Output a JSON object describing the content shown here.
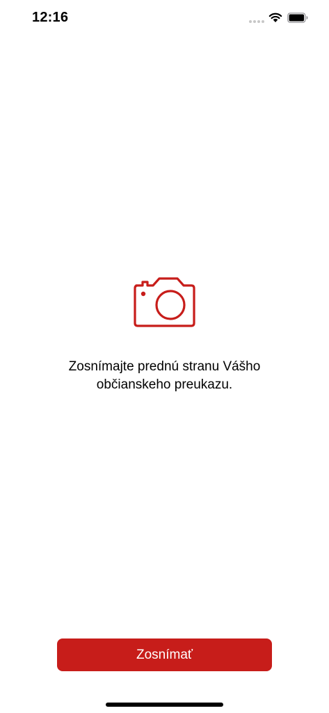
{
  "status_bar": {
    "time": "12:16"
  },
  "main": {
    "instruction": "Zosnímajte prednú stranu Vášho občianskeho preukazu.",
    "icon": "camera-icon"
  },
  "footer": {
    "capture_button_label": "Zosnímať"
  },
  "colors": {
    "accent": "#c71d1a",
    "background": "#ffffff",
    "text": "#000000"
  }
}
